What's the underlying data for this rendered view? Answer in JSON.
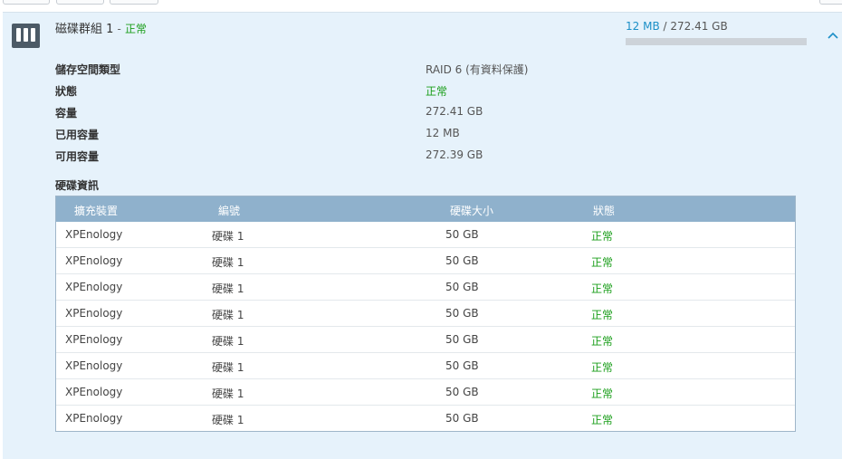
{
  "volume": {
    "name": "磁碟群組 1",
    "separator": "-",
    "status": "正常",
    "used": "12 MB",
    "usage_sep": "/",
    "total": "272.41 GB",
    "used_fraction": 4e-05,
    "collapse_glyph": "^"
  },
  "info": {
    "rows": [
      {
        "label": "儲存空間類型",
        "value": "RAID 6 (有資料保護)"
      },
      {
        "label": "狀態",
        "value": "正常"
      },
      {
        "label": "容量",
        "value": "272.41 GB"
      },
      {
        "label": "已用容量",
        "value": "12 MB"
      },
      {
        "label": "可用容量",
        "value": "272.39 GB"
      }
    ]
  },
  "disks": {
    "section_title": "硬碟資訊",
    "headers": [
      "擴充裝置",
      "編號",
      "硬碟大小",
      "狀態"
    ],
    "rows": [
      {
        "device": "XPEnology",
        "id": "硬碟 1",
        "size": "50 GB",
        "status": "正常"
      },
      {
        "device": "XPEnology",
        "id": "硬碟 1",
        "size": "50 GB",
        "status": "正常"
      },
      {
        "device": "XPEnology",
        "id": "硬碟 1",
        "size": "50 GB",
        "status": "正常"
      },
      {
        "device": "XPEnology",
        "id": "硬碟 1",
        "size": "50 GB",
        "status": "正常"
      },
      {
        "device": "XPEnology",
        "id": "硬碟 1",
        "size": "50 GB",
        "status": "正常"
      },
      {
        "device": "XPEnology",
        "id": "硬碟 1",
        "size": "50 GB",
        "status": "正常"
      },
      {
        "device": "XPEnology",
        "id": "硬碟 1",
        "size": "50 GB",
        "status": "正常"
      },
      {
        "device": "XPEnology",
        "id": "硬碟 1",
        "size": "50 GB",
        "status": "正常"
      }
    ]
  },
  "colors": {
    "accent": "#1b8fc7",
    "status_ok": "#1a9e1a",
    "panel_bg": "#e6f2fb",
    "table_header": "#8fb1cc"
  },
  "icons": {
    "volume": "disk-group-icon",
    "collapse": "chevron-up-icon"
  }
}
